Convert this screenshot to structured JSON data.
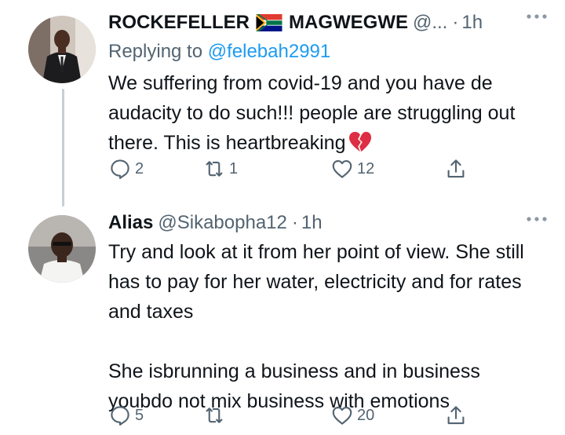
{
  "tweets": [
    {
      "name": "ROCKEFELLER",
      "name2": "MAGWEGWE",
      "handle": "@...",
      "dot": "·",
      "time": "1h",
      "replying_label": "Replying to",
      "replying_to": "@felebah2991",
      "text": "We suffering from covid-19 and you have de audacity to do such!!! people are struggling out there. This is heartbreaking",
      "replies": "2",
      "retweets": "1",
      "likes": "12"
    },
    {
      "name": "Alias",
      "handle": "@Sikabopha12",
      "dot": "·",
      "time": "1h",
      "text": "Try and look at it from her point of view. She still has to pay for her water, electricity and for rates and taxes\n\nShe isbrunning a business and in business youbdo not mix business with emotions",
      "replies": "5",
      "retweets": "",
      "likes": "20"
    }
  ],
  "icons": {
    "flag": "south-africa-flag",
    "emoji": "broken-heart-emoji",
    "more": "more-dots-icon",
    "reply": "reply-icon",
    "retweet": "retweet-icon",
    "like": "heart-icon",
    "share": "share-icon"
  },
  "colors": {
    "text": "#0f1419",
    "secondary": "#536471",
    "link": "#1d9bf0",
    "thread_line": "#c4cfd6"
  }
}
